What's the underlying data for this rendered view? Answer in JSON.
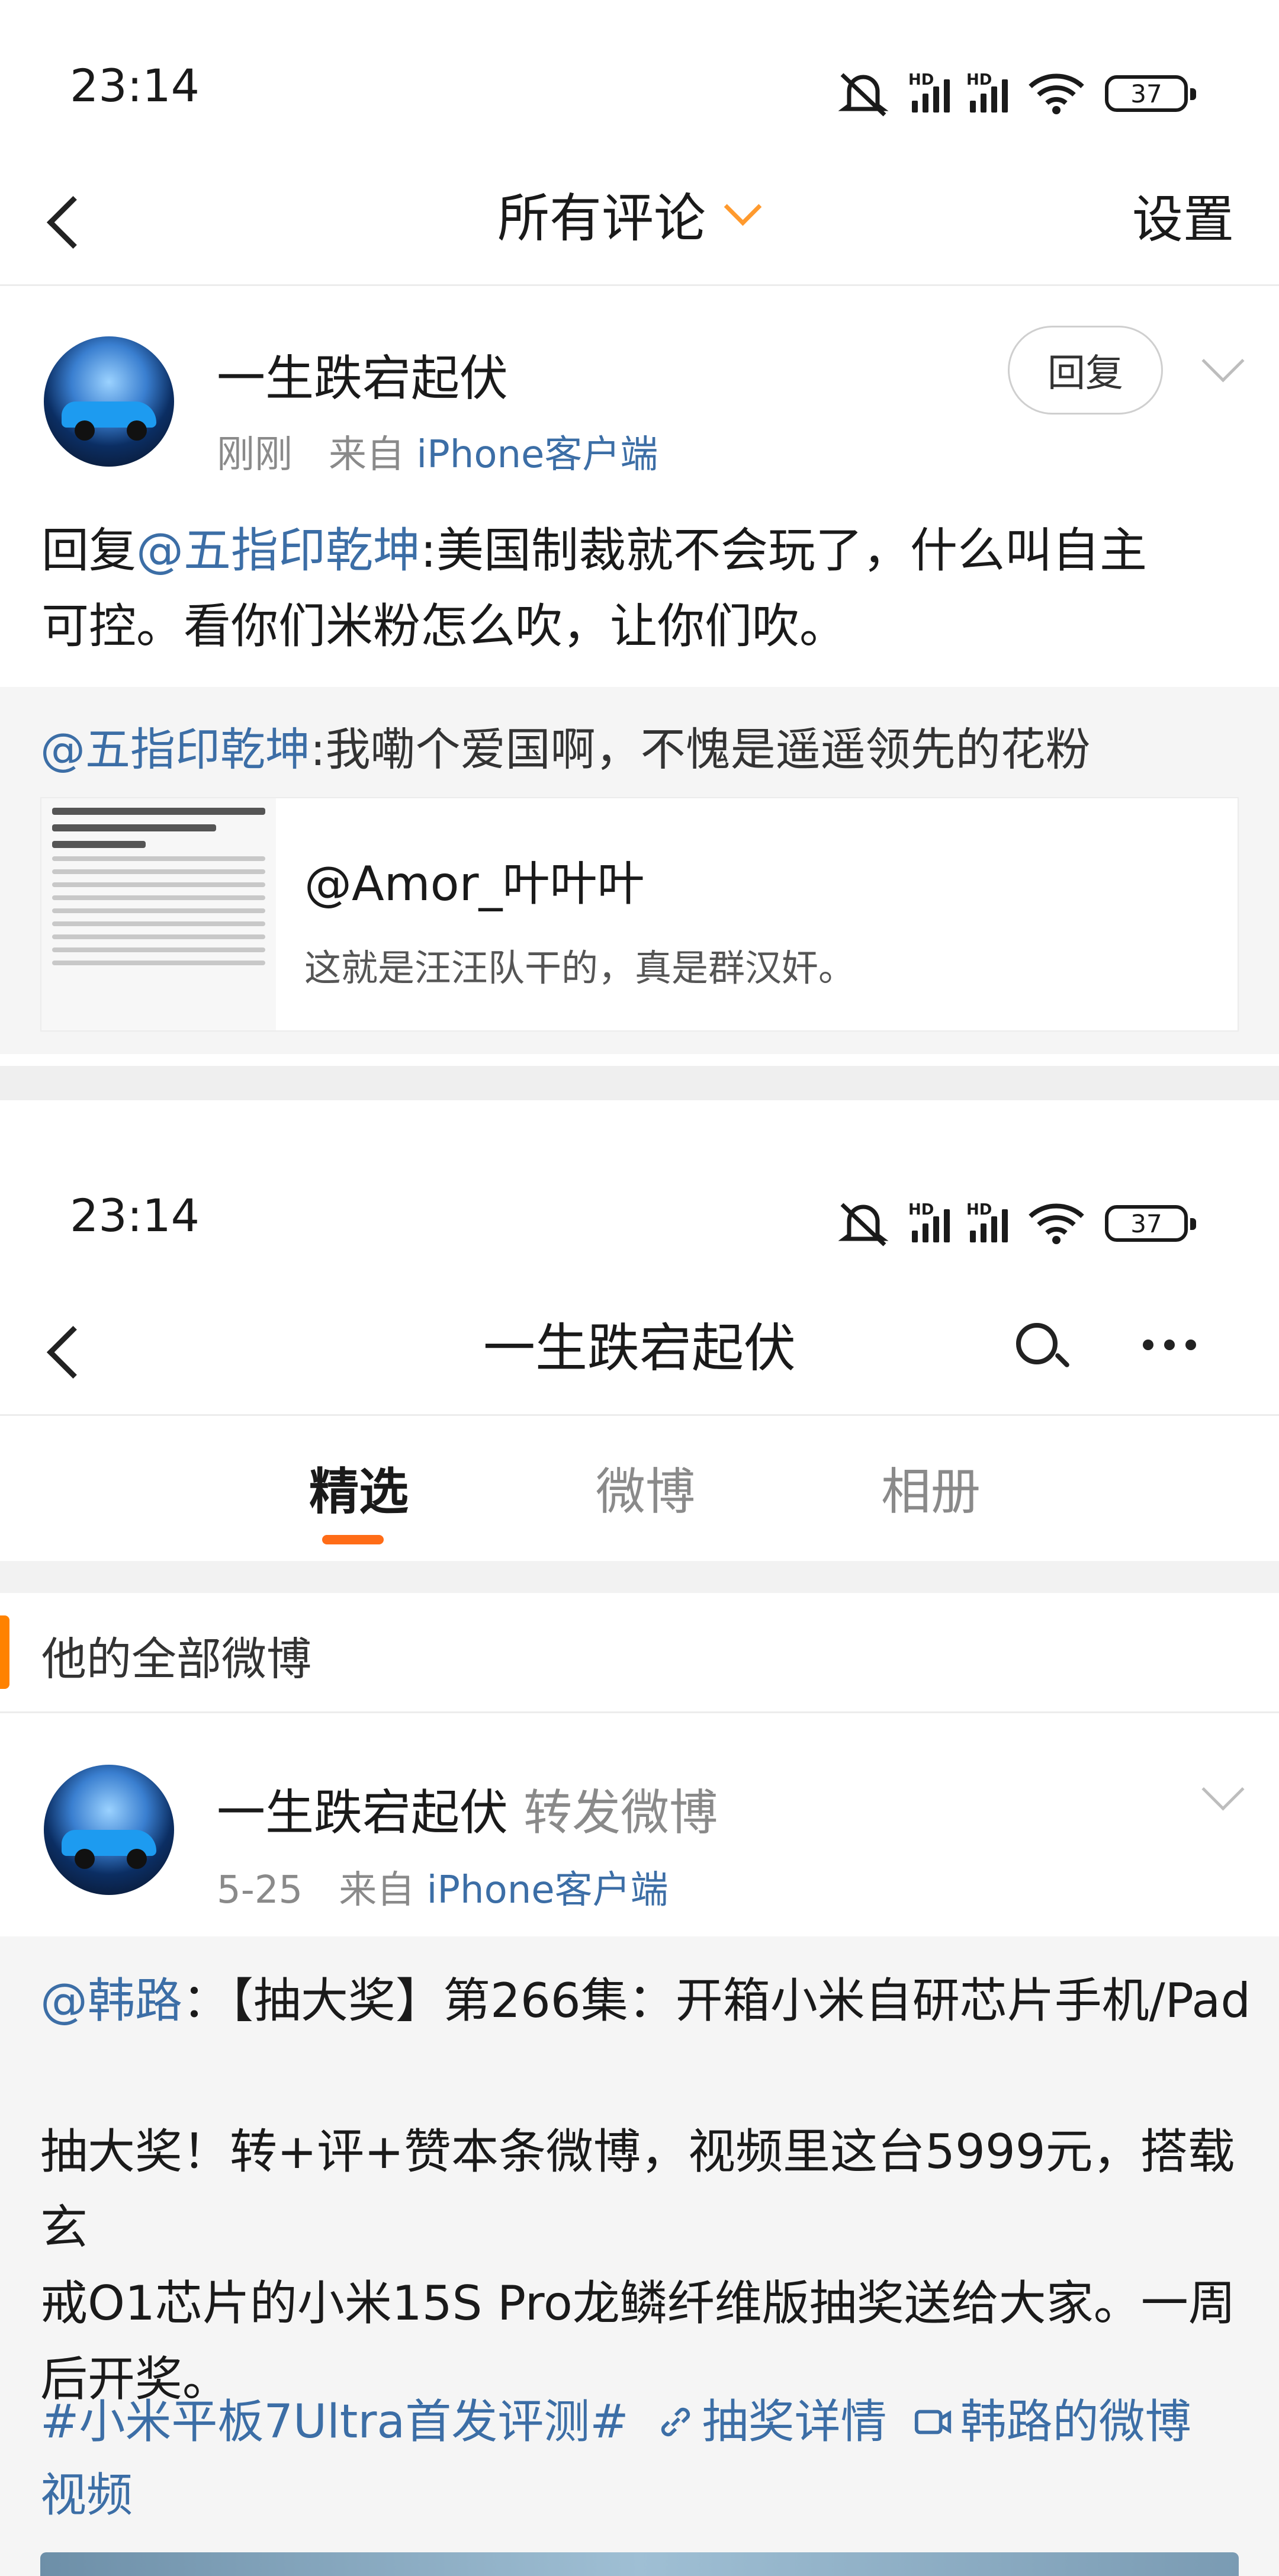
{
  "screen1": {
    "status": {
      "time": "23:14",
      "battery": "37",
      "network": "HD"
    },
    "nav": {
      "title": "所有评论",
      "settings": "设置"
    },
    "comment": {
      "username": "一生跌宕起伏",
      "time": "刚刚",
      "from_label": "来自",
      "source": "iPhone客户端",
      "reply_button": "回复",
      "reply_prefix": "回复",
      "mention": "@五指印乾坤",
      "text_line1": ":美国制裁就不会玩了，什么叫自主",
      "text_line2": "可控。看你们米粉怎么吹，让你们吹。"
    },
    "quoted": {
      "mention": "@五指印乾坤",
      "text": ":我嘞个爱国啊，不愧是遥遥领先的花粉",
      "card_user": "@Amor_叶叶叶",
      "card_text": "这就是汪汪队干的，真是群汉奸。"
    }
  },
  "screen2": {
    "status": {
      "time": "23:14",
      "battery": "37",
      "network": "HD"
    },
    "nav": {
      "title": "一生跌宕起伏"
    },
    "tabs": [
      {
        "label": "精选",
        "active": true
      },
      {
        "label": "微博",
        "active": false
      },
      {
        "label": "相册",
        "active": false
      }
    ],
    "section_title": "他的全部微博",
    "post": {
      "username": "一生跌宕起伏",
      "action": "转发微博",
      "date": "5-25",
      "from_label": "来自",
      "source": "iPhone客户端",
      "repost_mention": "@韩路",
      "repost_title": "：【抽大奖】第266集：开箱小米自研芯片手机/Pad",
      "body_line1": "抽大奖！转+评+赞本条微博，视频里这台5999元，搭载玄",
      "body_line2": "戒O1芯片的小米15S Pro龙鳞纤维版抽奖送给大家。一周",
      "body_line3": "后开奖。",
      "hashtag": "#小米平板7Ultra首发评测#",
      "lottery_link": "抽奖详情",
      "video_link": "韩路的微博",
      "video_suffix": "视频"
    }
  }
}
